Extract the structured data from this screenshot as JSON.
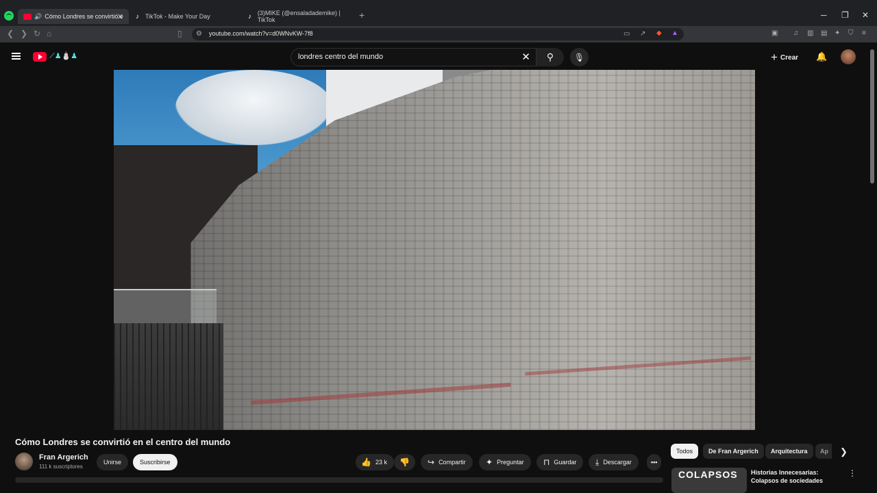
{
  "browser": {
    "tabs": [
      {
        "title": "Cómo Londres se convirtió e",
        "active": true,
        "audio_icon": "speaker-icon"
      },
      {
        "title": "TikTok - Make Your Day",
        "active": false
      },
      {
        "title": "(3)MIKE (@ensaladademike) | TikTok",
        "active": false
      }
    ],
    "url": "youtube.com/watch?v=d0WNvKW-7f8"
  },
  "youtube": {
    "search_query": "londres centro del mundo",
    "create_label": "Crear"
  },
  "video": {
    "title": "Cómo Londres se convirtió en el centro del mundo",
    "channel": "Fran Argerich",
    "subscribers": "111 k suscriptores",
    "join_label": "Unirse",
    "subscribe_label": "Suscribirse",
    "likes": "23 k",
    "share_label": "Compartir",
    "ask_label": "Preguntar",
    "save_label": "Guardar",
    "download_label": "Descargar"
  },
  "sidebar": {
    "chips": [
      "Todos",
      "De Fran Argerich",
      "Arquitectura",
      "Ap"
    ],
    "recommended": {
      "thumbnail_text": "COLAPSOS",
      "title": "Historias Innecesarias: Colapsos de sociedades"
    }
  },
  "colors": {
    "youtube_red": "#ff0033",
    "background": "#0f0f0f",
    "chip": "#272727"
  }
}
